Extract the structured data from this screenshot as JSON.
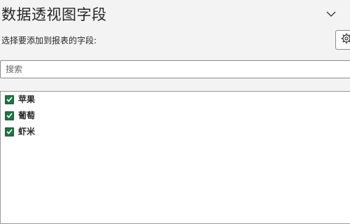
{
  "pane": {
    "title": "数据透视图字段",
    "collapse_icon": "chevron-down-icon"
  },
  "chooser": {
    "subtitle": "选择要添加到报表的字段:",
    "settings_icon": "gear-icon"
  },
  "search": {
    "placeholder": "搜索",
    "value": ""
  },
  "fields": [
    {
      "label": "苹果",
      "checked": true
    },
    {
      "label": "葡萄",
      "checked": true
    },
    {
      "label": "虾米",
      "checked": true
    }
  ],
  "colors": {
    "checkbox_fill": "#217346",
    "pane_background": "#f3f3f3"
  }
}
